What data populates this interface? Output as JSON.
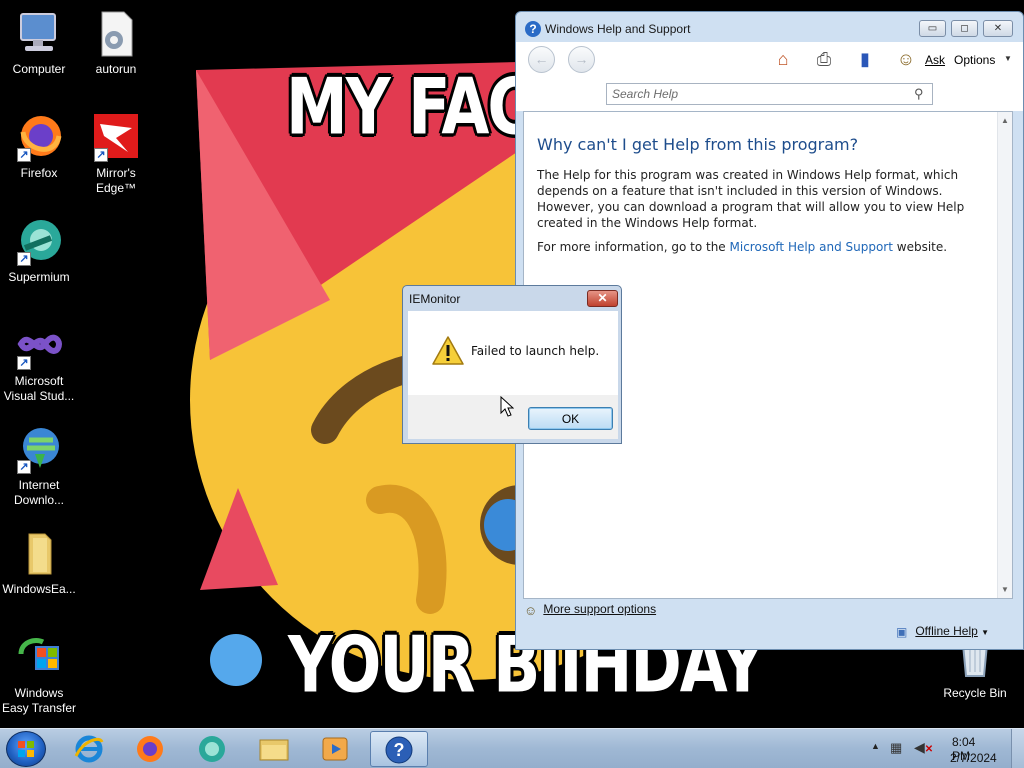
{
  "wallpaper": {
    "top_text": "MY FAC",
    "bottom_text": "YOUR BIIHDAY"
  },
  "desktop_icons": [
    {
      "label": "Computer",
      "icon": "computer-icon"
    },
    {
      "label": "autorun",
      "icon": "settings-file-icon"
    },
    {
      "label": "Firefox",
      "icon": "firefox-icon"
    },
    {
      "label": "Mirror's Edge™",
      "icon": "mirrors-edge-icon"
    },
    {
      "label": "Supermium",
      "icon": "supermium-icon"
    },
    {
      "label": "Microsoft Visual Stud...",
      "icon": "visual-studio-icon"
    },
    {
      "label": "Internet Downlo...",
      "icon": "internet-download-manager-icon"
    },
    {
      "label": "WindowsEa...",
      "icon": "folder-icon"
    },
    {
      "label": "Windows Easy Transfer",
      "icon": "easy-transfer-icon"
    },
    {
      "label": "Recycle Bin",
      "icon": "recycle-bin-icon"
    }
  ],
  "help_window": {
    "title": "Windows Help and Support",
    "caption_buttons": {
      "minimize": "▭",
      "maximize": "◻",
      "close": "✕"
    },
    "toolbar": {
      "back": "←",
      "forward": "→",
      "ask": "Ask",
      "options": "Options"
    },
    "search": {
      "placeholder": "Search Help"
    },
    "article": {
      "title": "Why can't I get Help from this program?",
      "paragraph1": "The Help for this program was created in Windows Help format, which depends on a feature that isn't included in this version of Windows. However, you can download a program that will allow you to view Help created in the Windows Help format.",
      "paragraph2_prefix": "For more information, go to the",
      "link": "Microsoft Help and Support",
      "paragraph2_suffix": "website."
    },
    "footer": {
      "more_support": "More support options",
      "offline_help": "Offline Help"
    }
  },
  "dialog": {
    "title": "IEMonitor",
    "message": "Failed to launch help.",
    "ok": "OK",
    "close": "✕"
  },
  "taskbar": {
    "pinned": [
      "internet-explorer-icon",
      "firefox-icon",
      "supermium-icon",
      "file-explorer-icon",
      "media-player-icon",
      "help-icon"
    ],
    "clock_time": "8:04 PM",
    "clock_date": "2/7/2024"
  },
  "colors": {
    "link": "#1f67b8",
    "article_title": "#1e4d8c",
    "window_frame": "#cfe0f2",
    "taskbar": "#9fb8d4"
  }
}
